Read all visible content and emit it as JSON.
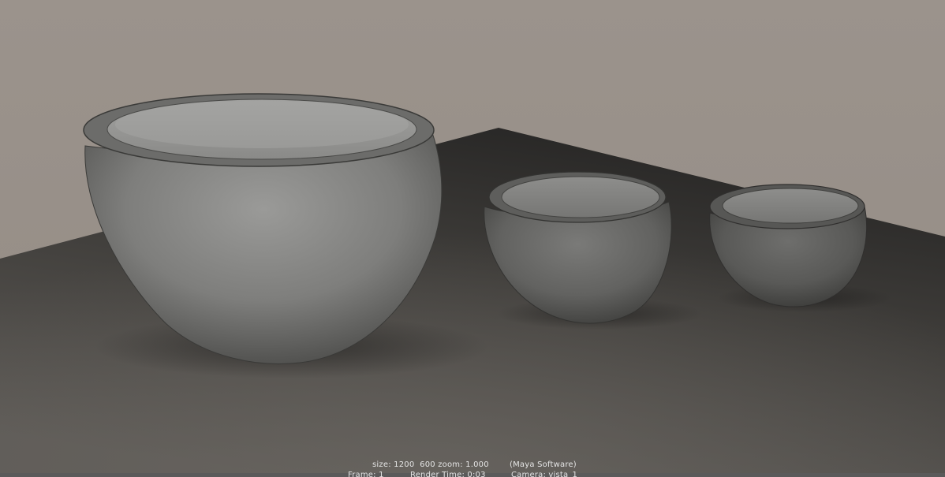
{
  "render_info": {
    "line1": {
      "size_text": "size: 1200  600 zoom: 1.000",
      "renderer_text": "(Maya Software)"
    },
    "line2": {
      "frame_text": "Frame: 1",
      "render_time_text": "Render Time: 0:03",
      "camera_text": "Camera: vista_1"
    }
  },
  "scene": {
    "description_objects": [
      "large-bowl",
      "medium-bowl",
      "small-bowl"
    ],
    "colors": {
      "wall": "#9a928b",
      "floor_dark": "#2e2c2a",
      "floor_light": "#66625e",
      "bowl": "#7a7a78"
    }
  }
}
